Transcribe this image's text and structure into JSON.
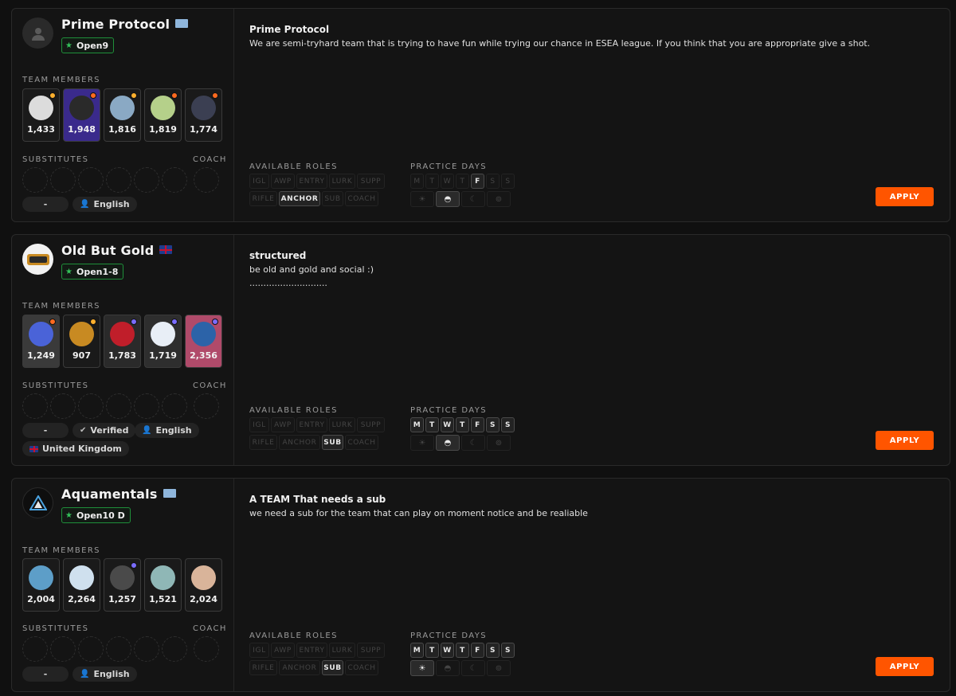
{
  "labels": {
    "members": "TEAM MEMBERS",
    "substitutes": "SUBSTITUTES",
    "coach": "COACH",
    "roles": "AVAILABLE ROLES",
    "days": "PRACTICE DAYS",
    "apply": "APPLY"
  },
  "role_names": [
    "IGL",
    "AWP",
    "ENTRY",
    "LURK",
    "SUPP",
    "RIFLE",
    "ANCHOR",
    "SUB",
    "COACH"
  ],
  "day_names": [
    "M",
    "T",
    "W",
    "T",
    "F",
    "S",
    "S"
  ],
  "teams": [
    {
      "name": "Prime Protocol",
      "flag": "world",
      "division": "Open9",
      "members": [
        {
          "elo": "1,433",
          "color": "#dcdcdc",
          "level_color": "#ffb02e"
        },
        {
          "elo": "1,948",
          "color": "#5a3fc0",
          "level_color": "#ff6a1f"
        },
        {
          "elo": "1,816",
          "color": "#8aa9c4",
          "level_color": "#ffb02e"
        },
        {
          "elo": "1,819",
          "color": "#b5d08a",
          "level_color": "#ff6a1f"
        },
        {
          "elo": "1,774",
          "color": "#3b3f52",
          "level_color": "#ff6a1f"
        }
      ],
      "info": [
        "-",
        "English"
      ],
      "desc_title": "Prime Protocol",
      "desc": "We are semi-tryhard team that is trying to have fun while trying our chance in ESEA league. If you think that you are appropriate give a shot.",
      "roles_on": [
        "ANCHOR"
      ],
      "days_on": [
        4
      ],
      "slots_on": [
        1
      ]
    },
    {
      "name": "Old But Gold",
      "flag": "uk",
      "division": "Open1-8",
      "members": [
        {
          "elo": "1,249",
          "color": "#4a63d8",
          "level_color": "#ff6a1f"
        },
        {
          "elo": "907",
          "color": "#c88a22",
          "level_color": "#ffb02e"
        },
        {
          "elo": "1,783",
          "color": "#c01e2a",
          "level_color": "#7a6cff"
        },
        {
          "elo": "1,719",
          "color": "#e8eef6",
          "level_color": "#7a6cff"
        },
        {
          "elo": "2,356",
          "color": "#2c63a8",
          "level_color": "#7a6cff"
        }
      ],
      "info": [
        "-",
        "Verified",
        "English",
        "United Kingdom"
      ],
      "desc_title": "structured",
      "desc": "be old and gold and social :)\n............................",
      "roles_on": [
        "SUB"
      ],
      "days_on": [
        0,
        1,
        2,
        3,
        4,
        5,
        6
      ],
      "slots_on": [
        1
      ]
    },
    {
      "name": "Aquamentals",
      "flag": "world",
      "division": "Open10 D",
      "members": [
        {
          "elo": "2,004",
          "color": "#5d9ec8",
          "level_color": ""
        },
        {
          "elo": "2,264",
          "color": "#cfe0ee",
          "level_color": ""
        },
        {
          "elo": "1,257",
          "color": "#4a4a4a",
          "level_color": "#7a6cff"
        },
        {
          "elo": "1,521",
          "color": "#8fb7b6",
          "level_color": ""
        },
        {
          "elo": "2,024",
          "color": "#d9b49a",
          "level_color": ""
        }
      ],
      "info": [
        "-",
        "English"
      ],
      "desc_title": "A TEAM That needs a sub",
      "desc": "we need a sub for the team that can play on moment notice and be realiable",
      "roles_on": [
        "SUB"
      ],
      "days_on": [
        0,
        1,
        2,
        3,
        4,
        5,
        6
      ],
      "slots_on": [
        0
      ]
    }
  ],
  "time_slot_icons": [
    "sun-icon",
    "half-sun-icon",
    "moon-icon",
    "owl-icon"
  ],
  "colors": {
    "accent": "#ff5500",
    "division_border": "#1f8f3a"
  }
}
